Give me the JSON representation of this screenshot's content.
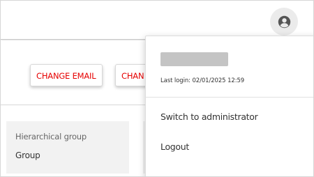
{
  "header": {
    "account_icon": "account-circle-icon"
  },
  "actions": {
    "change_email_label": "CHANGE EMAIL",
    "second_button_label": "CHAN"
  },
  "details": {
    "hierarchical_group_label": "Hierarchical group",
    "hierarchical_group_value": "Group"
  },
  "account_menu": {
    "last_login": "Last login: 02/01/2025 12:59",
    "items": [
      {
        "label": "Switch to administrator"
      },
      {
        "label": "Logout"
      }
    ]
  },
  "colors": {
    "accent": "#e60000",
    "card_background": "#f2f2f2"
  }
}
